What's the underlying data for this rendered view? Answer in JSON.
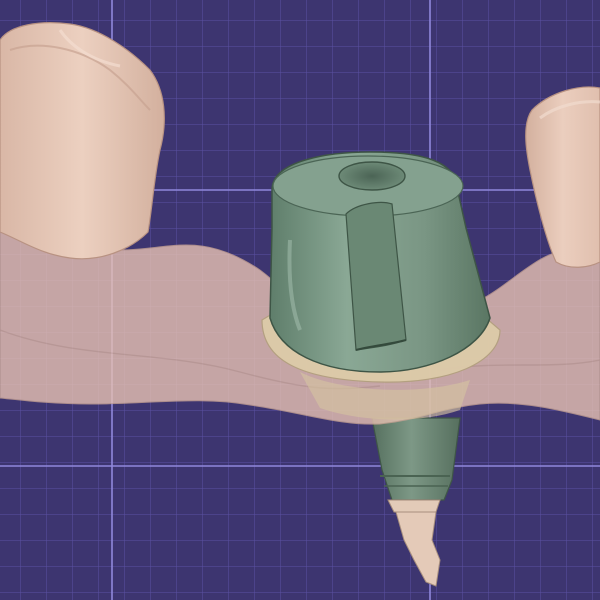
{
  "viewport": {
    "background_color": "#3d3570",
    "grid": {
      "visible": true,
      "minor_color": "#5a50a0",
      "major_color": "#8a80d8"
    }
  },
  "scene": {
    "objects": [
      {
        "name": "gingiva-model",
        "color": "#e8c4b4",
        "opacity": 0.78,
        "translucent": true
      },
      {
        "name": "adjacent-tooth-left",
        "color": "#e6c6b6"
      },
      {
        "name": "adjacent-tooth-right",
        "color": "#e6c6b6"
      },
      {
        "name": "implant-abutment",
        "color": "#7c9a86"
      },
      {
        "name": "abutment-margin-collar",
        "color": "#d8caa8"
      },
      {
        "name": "implant-body",
        "color": "#6f8c78"
      },
      {
        "name": "implant-apex-tissue",
        "color": "#e2c8b6"
      }
    ]
  }
}
